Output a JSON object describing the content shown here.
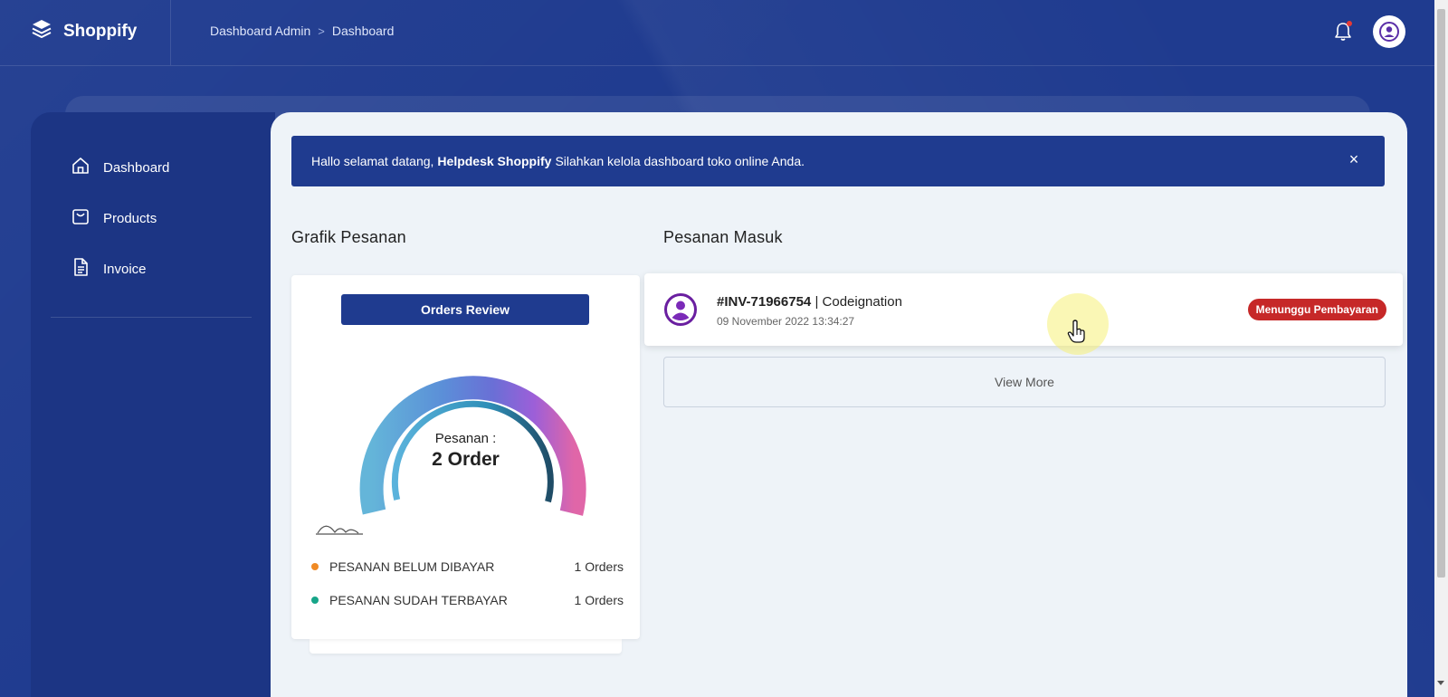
{
  "app": {
    "brand": "Shoppify"
  },
  "breadcrumb": {
    "root": "Dashboard Admin",
    "separator": ">",
    "current": "Dashboard"
  },
  "sidebar": {
    "items": [
      {
        "label": "Dashboard",
        "icon": "home-icon"
      },
      {
        "label": "Products",
        "icon": "shopping-bag-icon"
      },
      {
        "label": "Invoice",
        "icon": "document-icon"
      }
    ]
  },
  "alert": {
    "prefix": "Hallo selamat datang,",
    "name": "Helpdesk Shoppify",
    "suffix": "Silahkan kelola dashboard toko online Anda.",
    "close": "×"
  },
  "chart_section": {
    "title": "Grafik Pesanan",
    "button": "Orders Review",
    "center_label": "Pesanan :",
    "center_value": "2 Order",
    "legend": [
      {
        "label": "PESANAN BELUM DIBAYAR",
        "value": "1 Orders",
        "color": "#f08a24"
      },
      {
        "label": "PESANAN SUDAH TERBAYAR",
        "value": "1 Orders",
        "color": "#17a589"
      }
    ]
  },
  "orders_section": {
    "title": "Pesanan Masuk",
    "orders": [
      {
        "invoice": "#INV-71966754",
        "customer": "Codeignation",
        "date": "09 November 2022 13:34:27",
        "status": "Menunggu Pembayaran",
        "status_color": "#c62828"
      }
    ],
    "view_more": "View More"
  },
  "colors": {
    "primary": "#1f3b8f",
    "sidebar": "#1c3584",
    "panel": "#eef3f8",
    "badge": "#c62828"
  }
}
